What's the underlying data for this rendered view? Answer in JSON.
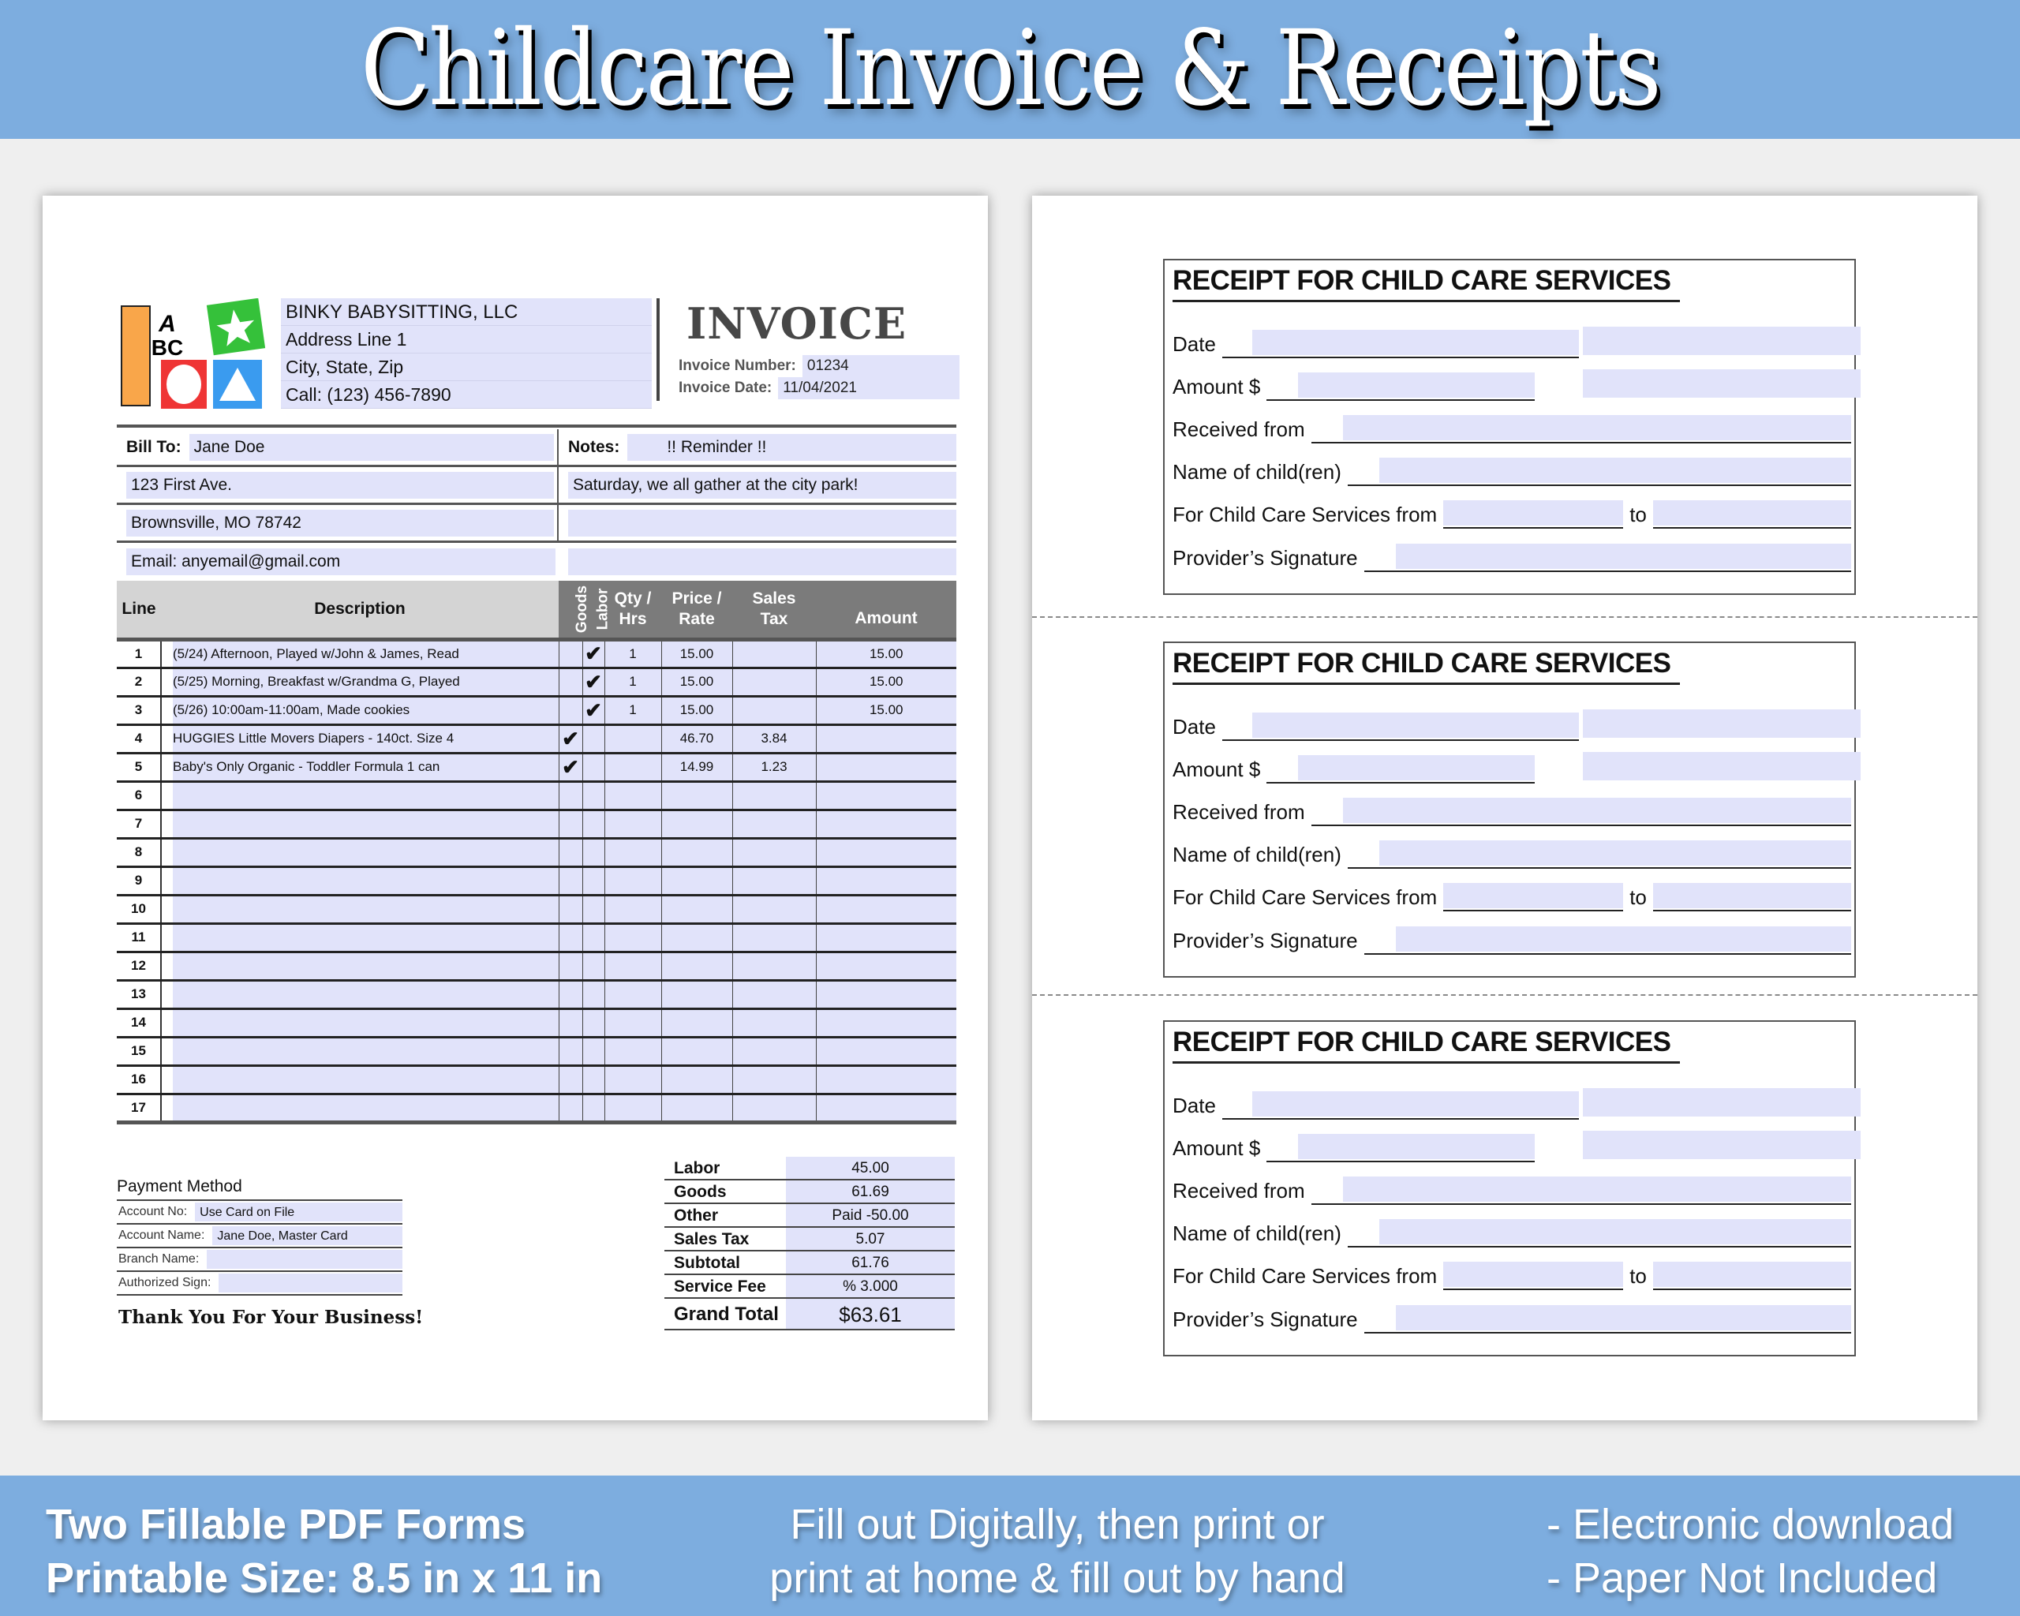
{
  "banner": {
    "title": "Childcare Invoice & Receipts",
    "left_lines": [
      "Two Fillable PDF Forms",
      "Printable Size: 8.5 in x 11 in"
    ],
    "center_lines": [
      "Fill out Digitally, then print or",
      "print at home & fill out by hand"
    ],
    "right_lines": [
      "- Electronic download",
      "- Paper Not Included"
    ],
    "color": "#7daddf"
  },
  "invoice": {
    "logo": {
      "letters_top": "A",
      "letters_bottom": "BC",
      "icons": [
        "orange-block",
        "abc-block",
        "green-star-block",
        "red-circle-block",
        "blue-triangle-block"
      ]
    },
    "company": [
      "BINKY BABYSITTING, LLC",
      "Address Line 1",
      "City, State, Zip",
      "Call: (123) 456-7890"
    ],
    "title": "INVOICE",
    "number_label": "Invoice Number:",
    "number": "01234",
    "date_label": "Invoice Date:",
    "date": "11/04/2021",
    "bill_to_label": "Bill To:",
    "bill_to": [
      "Jane Doe",
      "123 First Ave.",
      "Brownsville, MO 78742",
      "Email: anyemail@gmail.com"
    ],
    "notes_label": "Notes:",
    "notes": [
      "!! Reminder !!",
      "Saturday, we all gather at the city park!",
      "",
      ""
    ],
    "columns": {
      "line": "Line",
      "description": "Description",
      "goods": "Goods",
      "labor": "Labor",
      "qty": [
        "Qty /",
        "Hrs"
      ],
      "price": [
        "Price /",
        "Rate"
      ],
      "tax": [
        "Sales",
        "Tax"
      ],
      "amount": "Amount"
    },
    "check_mark": "✔",
    "items": [
      {
        "line": "1",
        "description": "(5/24) Afternoon, Played w/John & James, Read",
        "goods": "",
        "labor": "✔",
        "qty": "1",
        "price": "15.00",
        "tax": "",
        "amount": "15.00"
      },
      {
        "line": "2",
        "description": "(5/25) Morning, Breakfast w/Grandma G, Played",
        "goods": "",
        "labor": "✔",
        "qty": "1",
        "price": "15.00",
        "tax": "",
        "amount": "15.00"
      },
      {
        "line": "3",
        "description": "(5/26) 10:00am-11:00am, Made cookies",
        "goods": "",
        "labor": "✔",
        "qty": "1",
        "price": "15.00",
        "tax": "",
        "amount": "15.00"
      },
      {
        "line": "4",
        "description": "HUGGIES Little Movers Diapers - 140ct. Size 4",
        "goods": "✔",
        "labor": "",
        "qty": "",
        "price": "46.70",
        "tax": "3.84",
        "amount": ""
      },
      {
        "line": "5",
        "description": "Baby's Only Organic - Toddler Formula 1 can",
        "goods": "✔",
        "labor": "",
        "qty": "",
        "price": "14.99",
        "tax": "1.23",
        "amount": ""
      },
      {
        "line": "6",
        "description": "",
        "goods": "",
        "labor": "",
        "qty": "",
        "price": "",
        "tax": "",
        "amount": ""
      },
      {
        "line": "7",
        "description": "",
        "goods": "",
        "labor": "",
        "qty": "",
        "price": "",
        "tax": "",
        "amount": ""
      },
      {
        "line": "8",
        "description": "",
        "goods": "",
        "labor": "",
        "qty": "",
        "price": "",
        "tax": "",
        "amount": ""
      },
      {
        "line": "9",
        "description": "",
        "goods": "",
        "labor": "",
        "qty": "",
        "price": "",
        "tax": "",
        "amount": ""
      },
      {
        "line": "10",
        "description": "",
        "goods": "",
        "labor": "",
        "qty": "",
        "price": "",
        "tax": "",
        "amount": ""
      },
      {
        "line": "11",
        "description": "",
        "goods": "",
        "labor": "",
        "qty": "",
        "price": "",
        "tax": "",
        "amount": ""
      },
      {
        "line": "12",
        "description": "",
        "goods": "",
        "labor": "",
        "qty": "",
        "price": "",
        "tax": "",
        "amount": ""
      },
      {
        "line": "13",
        "description": "",
        "goods": "",
        "labor": "",
        "qty": "",
        "price": "",
        "tax": "",
        "amount": ""
      },
      {
        "line": "14",
        "description": "",
        "goods": "",
        "labor": "",
        "qty": "",
        "price": "",
        "tax": "",
        "amount": ""
      },
      {
        "line": "15",
        "description": "",
        "goods": "",
        "labor": "",
        "qty": "",
        "price": "",
        "tax": "",
        "amount": ""
      },
      {
        "line": "16",
        "description": "",
        "goods": "",
        "labor": "",
        "qty": "",
        "price": "",
        "tax": "",
        "amount": ""
      },
      {
        "line": "17",
        "description": "",
        "goods": "",
        "labor": "",
        "qty": "",
        "price": "",
        "tax": "",
        "amount": ""
      }
    ],
    "payment": {
      "title": "Payment Method",
      "fields": [
        {
          "label": "Account No:",
          "value": "Use Card on File"
        },
        {
          "label": "Account Name:",
          "value": "Jane Doe, Master Card"
        },
        {
          "label": "Branch Name:",
          "value": ""
        },
        {
          "label": "Authorized Sign:",
          "value": ""
        }
      ]
    },
    "thanks": "Thank You For Your Business!",
    "totals": [
      {
        "label": "Labor",
        "value": "45.00"
      },
      {
        "label": "Goods",
        "value": "61.69"
      },
      {
        "label": "Other",
        "value": "Paid  -50.00"
      },
      {
        "label": "Sales Tax",
        "value": "5.07"
      },
      {
        "label": "Subtotal",
        "value": "61.76"
      },
      {
        "label": "Service Fee",
        "value": "% 3.000"
      },
      {
        "label": "Grand Total",
        "value": "$63.61"
      }
    ]
  },
  "receipts": {
    "title": "RECEIPT FOR CHILD CARE SERVICES",
    "labels": {
      "date": "Date",
      "amount": "Amount $",
      "received_from": "Received from",
      "children": "Name of child(ren)",
      "services_from": "For Child Care Services from",
      "to": "to",
      "signature": "Provider’s Signature"
    },
    "count": 3
  },
  "colors": {
    "field_fill": "#e1e3fa",
    "header_dark": "#7b7b7b",
    "header_light": "#d4d4d4"
  }
}
